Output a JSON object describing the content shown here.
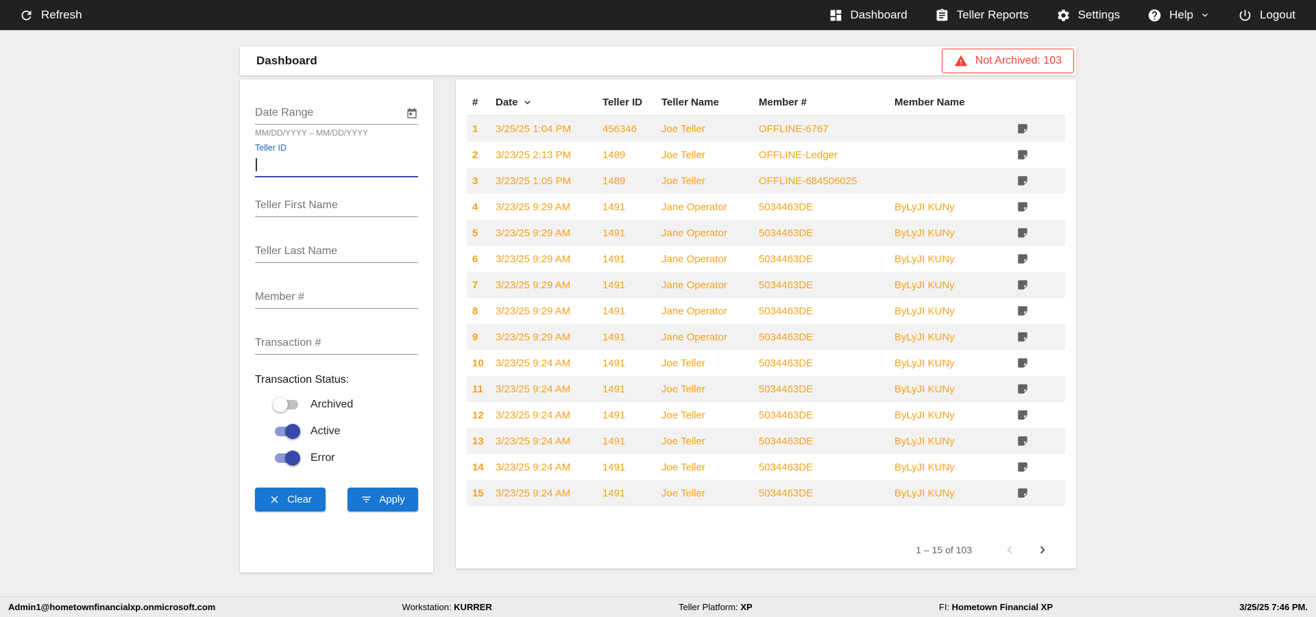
{
  "topbar": {
    "refresh": "Refresh",
    "nav": {
      "dashboard": "Dashboard",
      "teller_reports": "Teller Reports",
      "settings": "Settings",
      "help": "Help",
      "logout": "Logout"
    }
  },
  "header": {
    "title": "Dashboard",
    "not_archived": "Not Archived: 103"
  },
  "filters": {
    "date_range": {
      "placeholder": "Date Range",
      "hint": "MM/DD/YYYY – MM/DD/YYYY"
    },
    "teller_id": {
      "label": "Teller ID",
      "value": ""
    },
    "teller_first_name": {
      "placeholder": "Teller First Name"
    },
    "teller_last_name": {
      "placeholder": "Teller Last Name"
    },
    "member_number": {
      "placeholder": "Member #"
    },
    "transaction_number": {
      "placeholder": "Transaction #"
    },
    "status_label": "Transaction Status:",
    "toggles": [
      {
        "label": "Archived",
        "on": false
      },
      {
        "label": "Active",
        "on": true
      },
      {
        "label": "Error",
        "on": true
      }
    ],
    "clear": "Clear",
    "apply": "Apply"
  },
  "table": {
    "columns": {
      "num": "#",
      "date": "Date",
      "teller_id": "Teller ID",
      "teller_name": "Teller Name",
      "member": "Member #",
      "member_name": "Member Name"
    },
    "sorted_by": "Date",
    "rows": [
      {
        "num": "1",
        "date": "3/25/25 1:04 PM",
        "teller_id": "456346",
        "teller_name": "Joe Teller",
        "member": "OFFLINE-6767",
        "member_name": ""
      },
      {
        "num": "2",
        "date": "3/23/25 2:13 PM",
        "teller_id": "1489",
        "teller_name": "Joe Teller",
        "member": "OFFLINE-Ledger",
        "member_name": ""
      },
      {
        "num": "3",
        "date": "3/23/25 1:05 PM",
        "teller_id": "1489",
        "teller_name": "Joe Teller",
        "member": "OFFLINE-684506025",
        "member_name": ""
      },
      {
        "num": "4",
        "date": "3/23/25 9:29 AM",
        "teller_id": "1491",
        "teller_name": "Jane Operator",
        "member": "5034463DE",
        "member_name": "ByLyJI KUNy"
      },
      {
        "num": "5",
        "date": "3/23/25 9:29 AM",
        "teller_id": "1491",
        "teller_name": "Jane Operator",
        "member": "5034463DE",
        "member_name": "ByLyJI KUNy"
      },
      {
        "num": "6",
        "date": "3/23/25 9:29 AM",
        "teller_id": "1491",
        "teller_name": "Jane Operator",
        "member": "5034463DE",
        "member_name": "ByLyJI KUNy"
      },
      {
        "num": "7",
        "date": "3/23/25 9:29 AM",
        "teller_id": "1491",
        "teller_name": "Jane Operator",
        "member": "5034463DE",
        "member_name": "ByLyJI KUNy"
      },
      {
        "num": "8",
        "date": "3/23/25 9:29 AM",
        "teller_id": "1491",
        "teller_name": "Jane Operator",
        "member": "5034463DE",
        "member_name": "ByLyJI KUNy"
      },
      {
        "num": "9",
        "date": "3/23/25 9:29 AM",
        "teller_id": "1491",
        "teller_name": "Jane Operator",
        "member": "5034463DE",
        "member_name": "ByLyJI KUNy"
      },
      {
        "num": "10",
        "date": "3/23/25 9:24 AM",
        "teller_id": "1491",
        "teller_name": "Joe Teller",
        "member": "5034463DE",
        "member_name": "ByLyJI KUNy"
      },
      {
        "num": "11",
        "date": "3/23/25 9:24 AM",
        "teller_id": "1491",
        "teller_name": "Joe Teller",
        "member": "5034463DE",
        "member_name": "ByLyJI KUNy"
      },
      {
        "num": "12",
        "date": "3/23/25 9:24 AM",
        "teller_id": "1491",
        "teller_name": "Joe Teller",
        "member": "5034463DE",
        "member_name": "ByLyJI KUNy"
      },
      {
        "num": "13",
        "date": "3/23/25 9:24 AM",
        "teller_id": "1491",
        "teller_name": "Joe Teller",
        "member": "5034463DE",
        "member_name": "ByLyJI KUNy"
      },
      {
        "num": "14",
        "date": "3/23/25 9:24 AM",
        "teller_id": "1491",
        "teller_name": "Joe Teller",
        "member": "5034463DE",
        "member_name": "ByLyJI KUNy"
      },
      {
        "num": "15",
        "date": "3/23/25 9:24 AM",
        "teller_id": "1491",
        "teller_name": "Joe Teller",
        "member": "5034463DE",
        "member_name": "ByLyJI KUNy"
      }
    ],
    "pagination": "1 – 15 of 103"
  },
  "footer": {
    "user": "Admin1@hometownfinancialxp.onmicrosoft.com",
    "workstation_label": "Workstation:",
    "workstation_value": "KURRER",
    "platform_label": "Teller Platform:",
    "platform_value": "XP",
    "fi_label": "FI:",
    "fi_value": "Hometown Financial XP",
    "timestamp": "3/25/25 7:46 PM."
  },
  "colors": {
    "accent_blue": "#1976d2",
    "data_orange": "#f7a11a",
    "alert_red": "#f44336",
    "toggle_on_blue": "#3949ab"
  }
}
